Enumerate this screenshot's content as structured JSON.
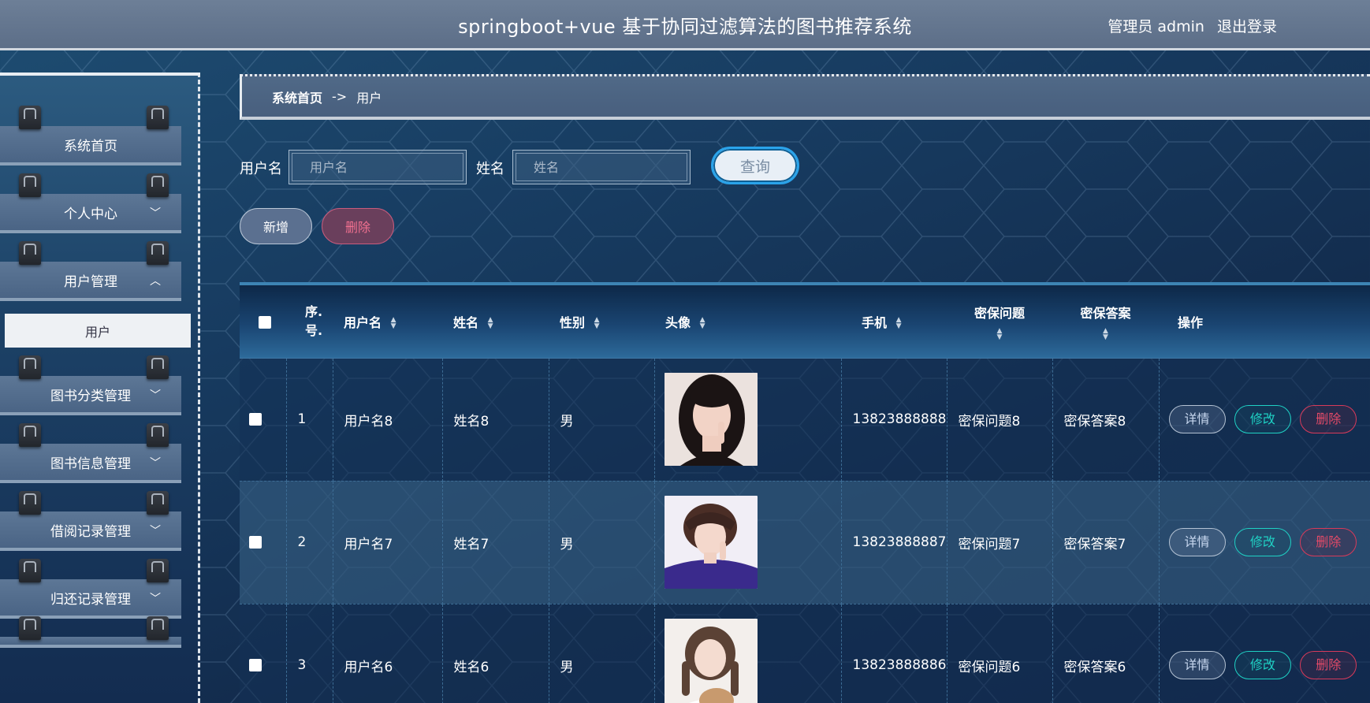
{
  "header": {
    "title": "springboot+vue 基于协同过滤算法的图书推荐系统",
    "user_label": "管理员 admin",
    "logout_label": "退出登录"
  },
  "sidebar": {
    "items": [
      {
        "label": "系统首页",
        "has_chevron": false
      },
      {
        "label": "个人中心",
        "chevron": "﹀"
      },
      {
        "label": "用户管理",
        "chevron": "︿"
      },
      {
        "label": "图书分类管理",
        "chevron": "﹀"
      },
      {
        "label": "图书信息管理",
        "chevron": "﹀"
      },
      {
        "label": "借阅记录管理",
        "chevron": "﹀"
      },
      {
        "label": "归还记录管理",
        "chevron": "﹀"
      }
    ],
    "active_sub": "用户"
  },
  "breadcrumb": {
    "home": "系统首页",
    "separator": "->",
    "current": "用户"
  },
  "search": {
    "username_label": "用户名",
    "username_placeholder": "用户名",
    "name_label": "姓名",
    "name_placeholder": "姓名",
    "query_label": "查询"
  },
  "actions": {
    "add_label": "新增",
    "delete_label": "删除"
  },
  "table": {
    "headers": {
      "index": "序.号.",
      "username": "用户名",
      "name": "姓名",
      "gender": "性别",
      "avatar": "头像",
      "phone": "手机",
      "question": "密保问题",
      "answer": "密保答案",
      "ops": "操作"
    },
    "rows": [
      {
        "index": "1",
        "username": "用户名8",
        "name": "姓名8",
        "gender": "男",
        "phone": "13823888888",
        "question": "密保问题8",
        "answer": "密保答案8"
      },
      {
        "index": "2",
        "username": "用户名7",
        "name": "姓名7",
        "gender": "男",
        "phone": "13823888887",
        "question": "密保问题7",
        "answer": "密保答案7"
      },
      {
        "index": "3",
        "username": "用户名6",
        "name": "姓名6",
        "gender": "男",
        "phone": "13823888886",
        "question": "密保问题6",
        "answer": "密保答案6"
      }
    ],
    "op_labels": {
      "detail": "详情",
      "edit": "修改",
      "delete": "删除"
    }
  },
  "colors": {
    "accent": "#2aa3ea",
    "edit": "#1fd1c4",
    "danger": "#e24a68"
  }
}
